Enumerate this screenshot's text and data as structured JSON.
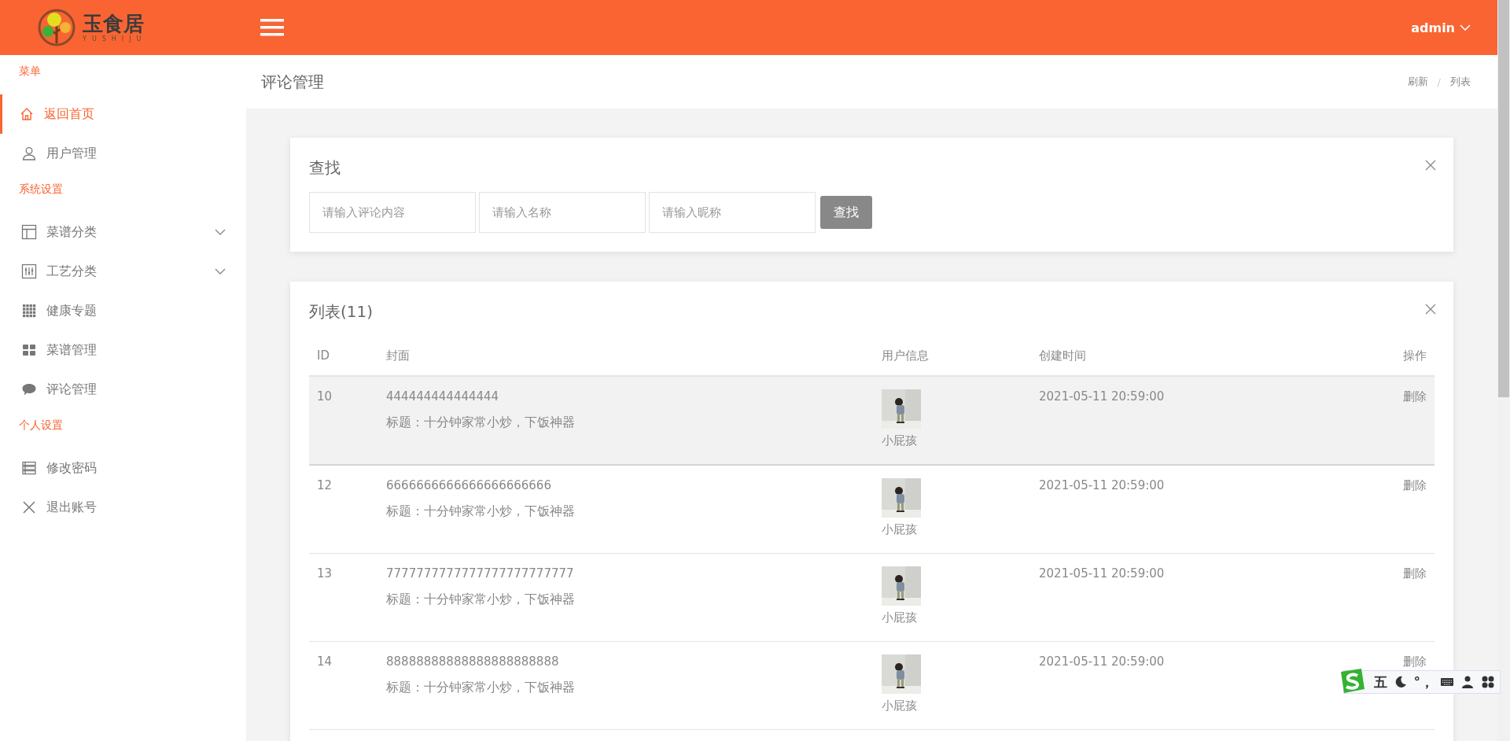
{
  "header": {
    "logo_text": "玉食居",
    "logo_subtitle": "YUSHIJU",
    "user": "admin"
  },
  "sidebar": {
    "sections": [
      {
        "title": "菜单",
        "items": [
          {
            "label": "返回首页",
            "selected": true,
            "expandable": false
          },
          {
            "label": "用户管理",
            "selected": false,
            "expandable": false
          }
        ]
      },
      {
        "title": "系统设置",
        "items": [
          {
            "label": "菜谱分类",
            "selected": false,
            "expandable": true
          },
          {
            "label": "工艺分类",
            "selected": false,
            "expandable": true
          },
          {
            "label": "健康专题",
            "selected": false,
            "expandable": false
          },
          {
            "label": "菜谱管理",
            "selected": false,
            "expandable": false
          },
          {
            "label": "评论管理",
            "selected": false,
            "expandable": false
          }
        ]
      },
      {
        "title": "个人设置",
        "items": [
          {
            "label": "修改密码",
            "selected": false,
            "expandable": false
          },
          {
            "label": "退出账号",
            "selected": false,
            "expandable": false
          }
        ]
      }
    ]
  },
  "page": {
    "title": "评论管理",
    "breadcrumb": {
      "items": [
        "刷新",
        "列表"
      ],
      "separator": "/"
    }
  },
  "search": {
    "title": "查找",
    "fields": [
      {
        "placeholder": "请输入评论内容"
      },
      {
        "placeholder": "请输入名称"
      },
      {
        "placeholder": "请输入昵称"
      }
    ],
    "button": "查找"
  },
  "table": {
    "title": "列表(11)",
    "columns": [
      "ID",
      "封面",
      "用户信息",
      "创建时间",
      "操作"
    ],
    "rows": [
      {
        "id": "10",
        "content": "444444444444444",
        "title": "标题：十分钟家常小炒，下饭神器",
        "nickname": "小屁孩",
        "created": "2021-05-11 20:59:00",
        "action": "删除",
        "hovered": true
      },
      {
        "id": "12",
        "content": "6666666666666666666666",
        "title": "标题：十分钟家常小炒，下饭神器",
        "nickname": "小屁孩",
        "created": "2021-05-11 20:59:00",
        "action": "删除",
        "hovered": false
      },
      {
        "id": "13",
        "content": "7777777777777777777777777",
        "title": "标题：十分钟家常小炒，下饭神器",
        "nickname": "小屁孩",
        "created": "2021-05-11 20:59:00",
        "action": "删除",
        "hovered": false
      },
      {
        "id": "14",
        "content": "88888888888888888888888",
        "title": "标题：十分钟家常小炒，下饭神器",
        "nickname": "小屁孩",
        "created": "2021-05-11 20:59:00",
        "action": "删除",
        "hovered": false
      }
    ]
  },
  "ime_toolbar": {
    "mode": "五",
    "punctuation": "°，"
  }
}
